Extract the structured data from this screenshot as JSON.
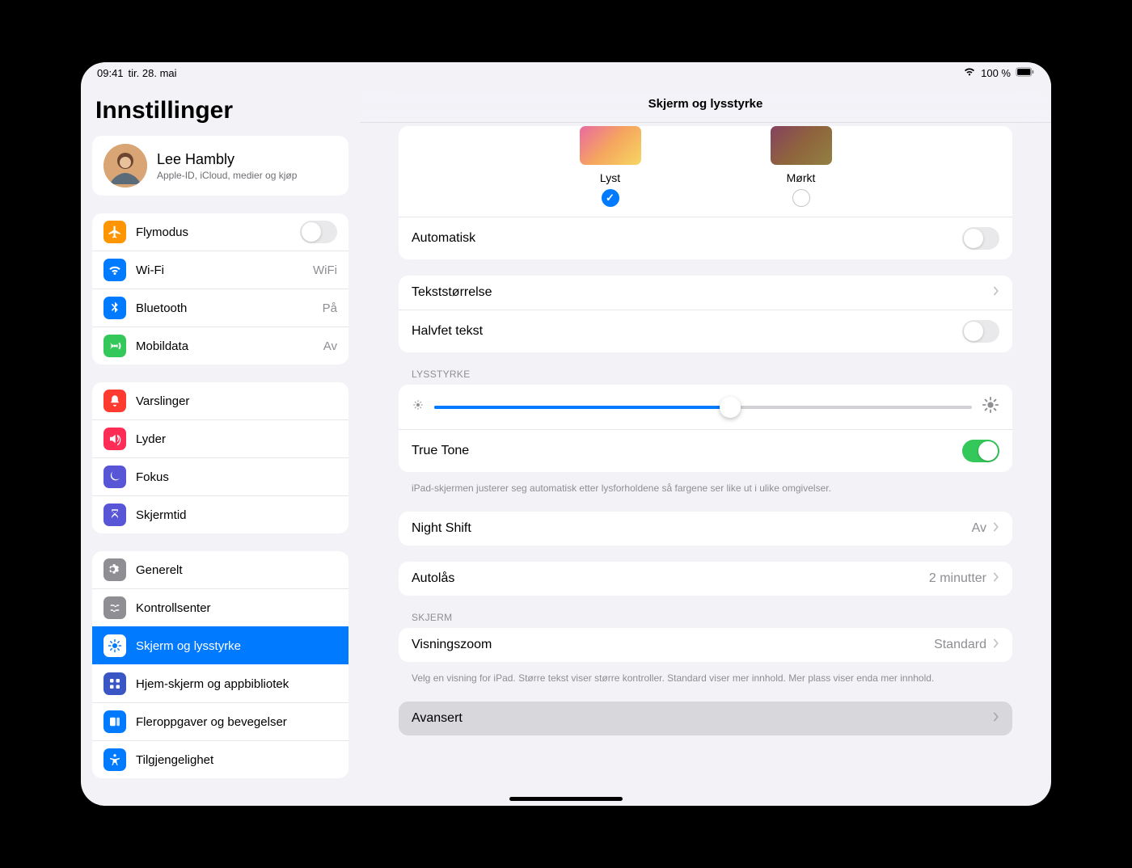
{
  "status": {
    "time": "09:41",
    "date": "tir. 28. mai",
    "battery": "100 %"
  },
  "sidebar": {
    "title": "Innstillinger",
    "profile": {
      "name": "Lee Hambly",
      "sub": "Apple-ID, iCloud, medier og kjøp"
    },
    "g1": {
      "airplane": "Flymodus",
      "wifi": "Wi-Fi",
      "wifi_val": "WiFi",
      "bt": "Bluetooth",
      "bt_val": "På",
      "cell": "Mobildata",
      "cell_val": "Av"
    },
    "g2": {
      "notif": "Varslinger",
      "sound": "Lyder",
      "focus": "Fokus",
      "screentime": "Skjermtid"
    },
    "g3": {
      "general": "Generelt",
      "control": "Kontrollsenter",
      "display": "Skjerm og lysstyrke",
      "home": "Hjem-skjerm og appbibliotek",
      "multi": "Fleroppgaver og bevegelser",
      "access": "Tilgjengelighet"
    }
  },
  "main": {
    "title": "Skjerm og lysstyrke",
    "appearance": {
      "light": "Lyst",
      "dark": "Mørkt"
    },
    "auto": "Automatisk",
    "textsize": "Tekststørrelse",
    "bold": "Halvfet tekst",
    "brightness_header": "LYSSTYRKE",
    "truetone": "True Tone",
    "truetone_footer": "iPad-skjermen justerer seg automatisk etter lysforholdene så fargene ser like ut i ulike omgivelser.",
    "nightshift": "Night Shift",
    "nightshift_val": "Av",
    "autolock": "Autolås",
    "autolock_val": "2 minutter",
    "screen_header": "SKJERM",
    "zoom": "Visningszoom",
    "zoom_val": "Standard",
    "zoom_footer": "Velg en visning for iPad. Større tekst viser større kontroller. Standard viser mer innhold. Mer plass viser enda mer innhold.",
    "advanced": "Avansert"
  }
}
